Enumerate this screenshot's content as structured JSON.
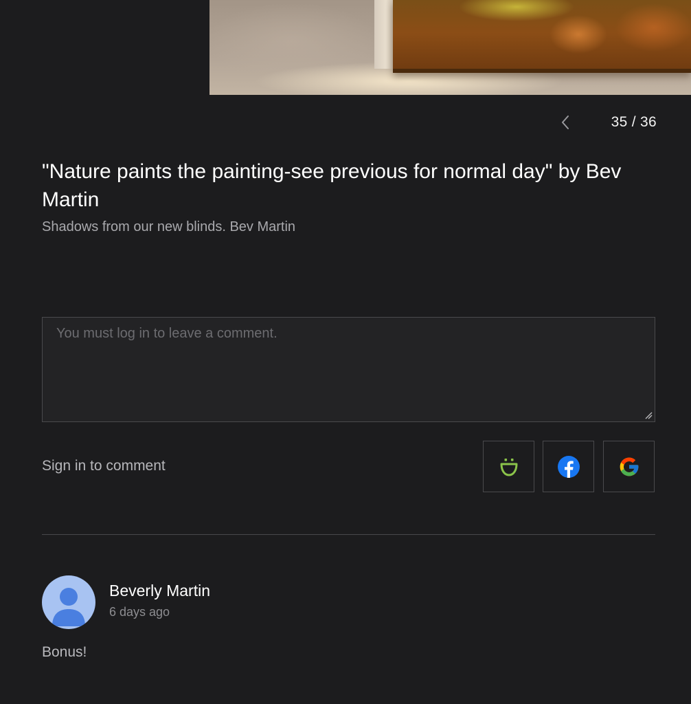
{
  "pager": {
    "count": "35 / 36"
  },
  "photo": {
    "title": "\"Nature paints the painting-see previous for normal day\" by Bev Martin",
    "caption": "Shadows from our new blinds. Bev Martin"
  },
  "comment_form": {
    "placeholder": "You must log in to leave a comment.",
    "sign_in_label": "Sign in to comment",
    "providers": [
      "smugmug-icon",
      "facebook-icon",
      "google-icon"
    ]
  },
  "comments": [
    {
      "author": "Beverly Martin",
      "time": "6 days ago",
      "text": "Bonus!"
    }
  ],
  "colors": {
    "background": "#1c1c1e",
    "smugmug_green": "#8bc34a",
    "facebook_blue": "#1877f2",
    "avatar_bg": "#a8c3f2",
    "avatar_fg": "#4a7fe0"
  }
}
